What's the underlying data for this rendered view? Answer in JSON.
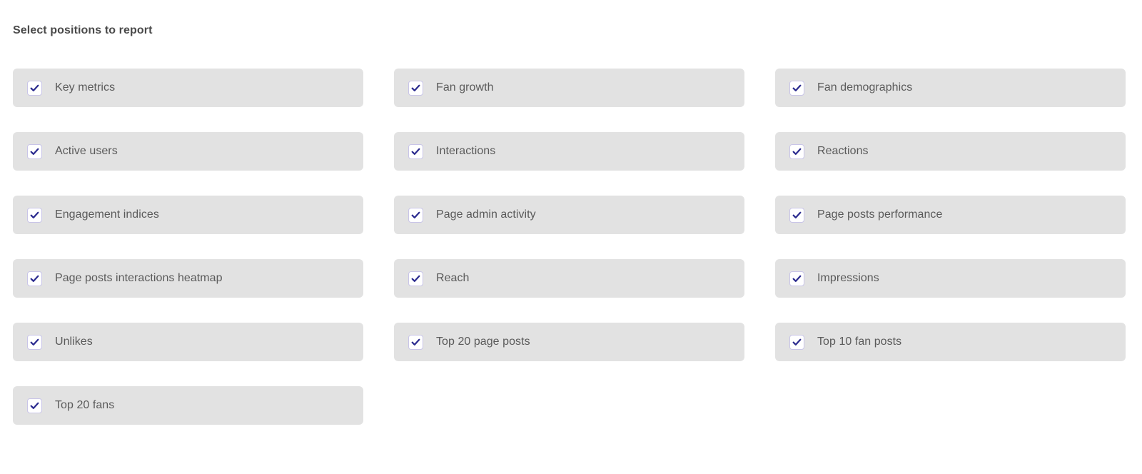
{
  "heading": "Select positions to report",
  "colors": {
    "page_background": "#ffffff",
    "card_background": "#e2e2e2",
    "label_text": "#5a5a5a",
    "heading_text": "#4a4a4a",
    "checkbox_border": "#c9c5e8",
    "checkbox_fill": "#ffffff",
    "check_mark": "#2b2b8f"
  },
  "options": [
    {
      "label": "Key metrics",
      "checked": true,
      "icon": "checkmark-icon"
    },
    {
      "label": "Fan growth",
      "checked": true,
      "icon": "checkmark-icon"
    },
    {
      "label": "Fan demographics",
      "checked": true,
      "icon": "checkmark-icon"
    },
    {
      "label": "Active users",
      "checked": true,
      "icon": "checkmark-icon"
    },
    {
      "label": "Interactions",
      "checked": true,
      "icon": "checkmark-icon"
    },
    {
      "label": "Reactions",
      "checked": true,
      "icon": "checkmark-icon"
    },
    {
      "label": "Engagement indices",
      "checked": true,
      "icon": "checkmark-icon"
    },
    {
      "label": "Page admin activity",
      "checked": true,
      "icon": "checkmark-icon"
    },
    {
      "label": "Page posts performance",
      "checked": true,
      "icon": "checkmark-icon"
    },
    {
      "label": "Page posts interactions heatmap",
      "checked": true,
      "icon": "checkmark-icon"
    },
    {
      "label": "Reach",
      "checked": true,
      "icon": "checkmark-icon"
    },
    {
      "label": "Impressions",
      "checked": true,
      "icon": "checkmark-icon"
    },
    {
      "label": "Unlikes",
      "checked": true,
      "icon": "checkmark-icon"
    },
    {
      "label": "Top 20 page posts",
      "checked": true,
      "icon": "checkmark-icon"
    },
    {
      "label": "Top 10 fan posts",
      "checked": true,
      "icon": "checkmark-icon"
    },
    {
      "label": "Top 20 fans",
      "checked": true,
      "icon": "checkmark-icon"
    }
  ]
}
